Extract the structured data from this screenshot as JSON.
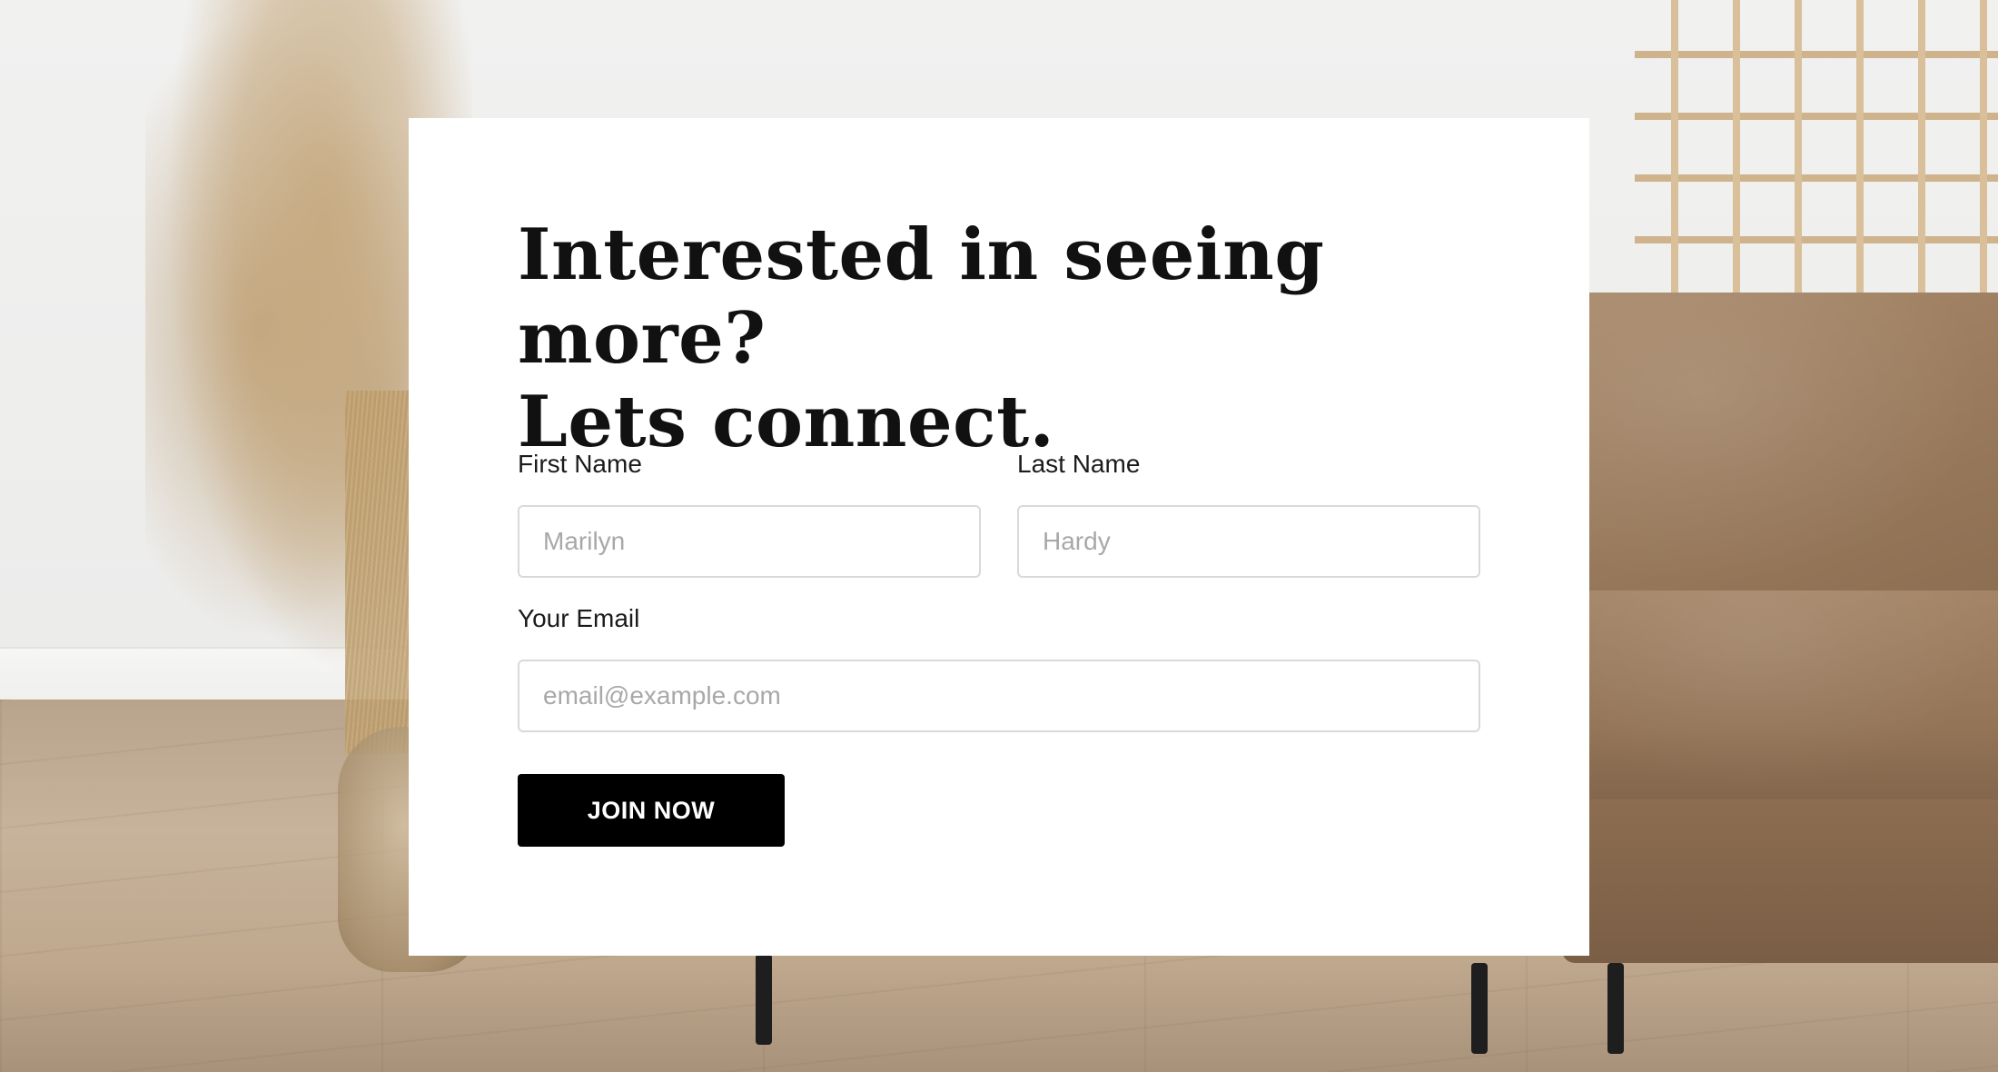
{
  "form": {
    "headline_line1": "Interested in seeing more?",
    "headline_line2": "Lets connect.",
    "first_name": {
      "label": "First Name",
      "placeholder": "Marilyn",
      "value": ""
    },
    "last_name": {
      "label": "Last Name",
      "placeholder": "Hardy",
      "value": ""
    },
    "email": {
      "label": "Your Email",
      "placeholder": "email@example.com",
      "value": ""
    },
    "submit_label": "JOIN NOW"
  },
  "colors": {
    "card_background": "#ffffff",
    "button_background": "#000000",
    "button_text": "#ffffff",
    "field_border": "#d9d9d9",
    "placeholder_text": "#a8a8a8"
  },
  "background": {
    "description_icon": "interior-photo"
  }
}
